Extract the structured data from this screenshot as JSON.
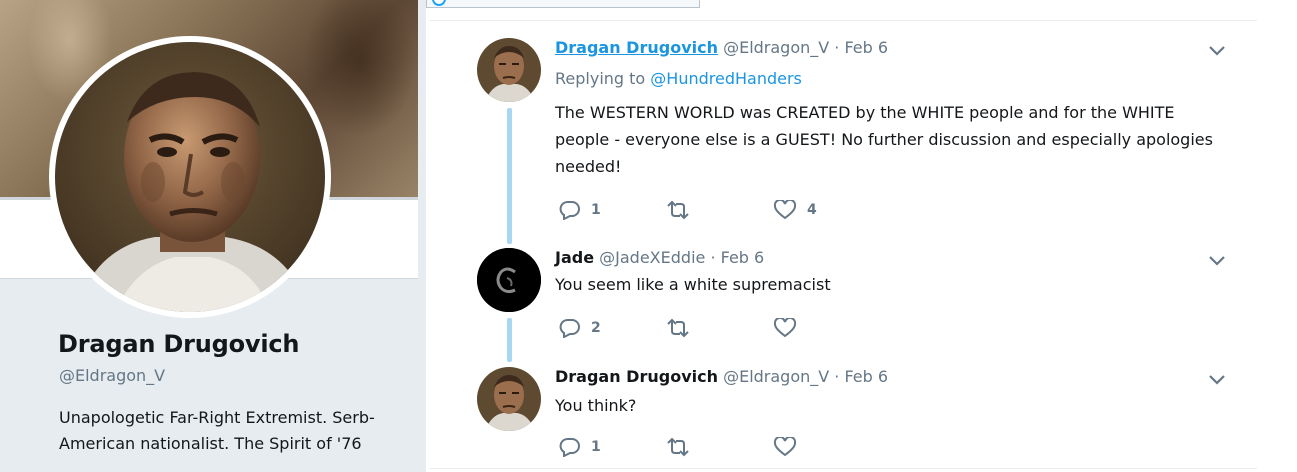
{
  "profile": {
    "name": "Dragan Drugovich",
    "handle": "@Eldragon_V",
    "bio": "Unapologetic Far-Right Extremist. Serb-American nationalist. The Spirit of '76"
  },
  "thread": [
    {
      "name": "Dragan Drugovich",
      "handle": "@Eldragon_V",
      "date": "· Feb 6",
      "replying_label": "Replying to",
      "replying_to": "@HundredHanders",
      "text": "The WESTERN WORLD was CREATED by the WHITE people and for the WHITE people - everyone else is a GUEST!  No further discussion and especially apologies needed!",
      "reply_count": "1",
      "retweet_count": "",
      "like_count": "4"
    },
    {
      "name": "Jade",
      "handle": "@JadeXEddie",
      "date": "· Feb 6",
      "text": "You seem like a white supremacist",
      "reply_count": "2",
      "retweet_count": "",
      "like_count": ""
    },
    {
      "name": "Dragan Drugovich",
      "handle": "@Eldragon_V",
      "date": "· Feb 6",
      "text": "You think?",
      "reply_count": "1",
      "retweet_count": "",
      "like_count": ""
    }
  ],
  "colors": {
    "link_blue": "#1b95e0",
    "muted_gray": "#657786",
    "thread_line_blue": "#a9d6f2",
    "page_bg": "#e6ecf0"
  },
  "icons": [
    "reply-icon",
    "retweet-icon",
    "like-icon",
    "chevron-down-icon"
  ]
}
